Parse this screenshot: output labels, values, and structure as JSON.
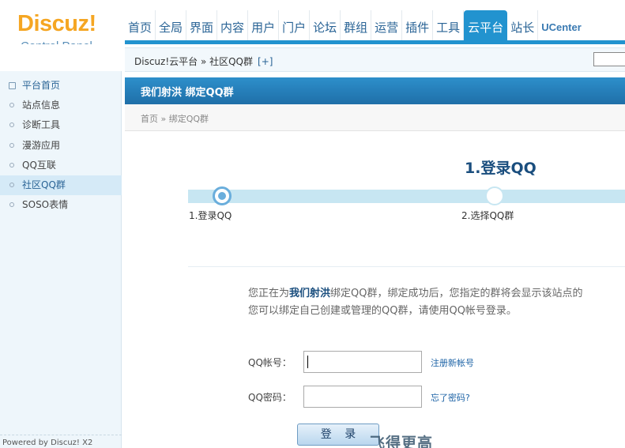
{
  "header": {
    "logo_brand": "Discuz!",
    "logo_sub": "Control Panel",
    "nav": [
      {
        "label": "首页"
      },
      {
        "label": "全局"
      },
      {
        "label": "界面"
      },
      {
        "label": "内容"
      },
      {
        "label": "用户"
      },
      {
        "label": "门户"
      },
      {
        "label": "论坛"
      },
      {
        "label": "群组"
      },
      {
        "label": "运营"
      },
      {
        "label": "插件"
      },
      {
        "label": "工具"
      },
      {
        "label": "云平台",
        "active": true
      },
      {
        "label": "站长"
      },
      {
        "label": "UCenter"
      }
    ]
  },
  "sidebar": {
    "items": [
      {
        "label": "平台首页"
      },
      {
        "label": "站点信息"
      },
      {
        "label": "诊断工具"
      },
      {
        "label": "漫游应用"
      },
      {
        "label": "QQ互联"
      },
      {
        "label": "社区QQ群"
      },
      {
        "label": "SOSO表情"
      }
    ],
    "powered": "Powered by Discuz! X2"
  },
  "main": {
    "breadcrumb": "Discuz!云平台 » 社区QQ群",
    "breadcrumb_add": "[+]",
    "title": "我们射洪 绑定QQ群",
    "subcrumb": "首页 » 绑定QQ群",
    "step_title": "1.登录QQ",
    "steps": [
      {
        "label": "1.登录QQ"
      },
      {
        "label": "2.选择QQ群"
      }
    ],
    "intro_line1_prefix": "您正在为",
    "intro_site": "我们射洪",
    "intro_line1_suffix": "绑定QQ群，绑定成功后，您指定的群将会显示该站点的",
    "intro_line2": "您可以绑定自己创建或管理的QQ群，请使用QQ帐号登录。",
    "form": {
      "qq_label": "QQ帐号：",
      "pw_label": "QQ密码：",
      "register_link": "注册新帐号",
      "forgot_link": "忘了密码?",
      "login_button": "登 录"
    },
    "watermark": "飞得更高"
  },
  "colors": {
    "accent": "#2293cf",
    "brand_orange": "#f5a623",
    "progress": "#c7e6f2"
  }
}
